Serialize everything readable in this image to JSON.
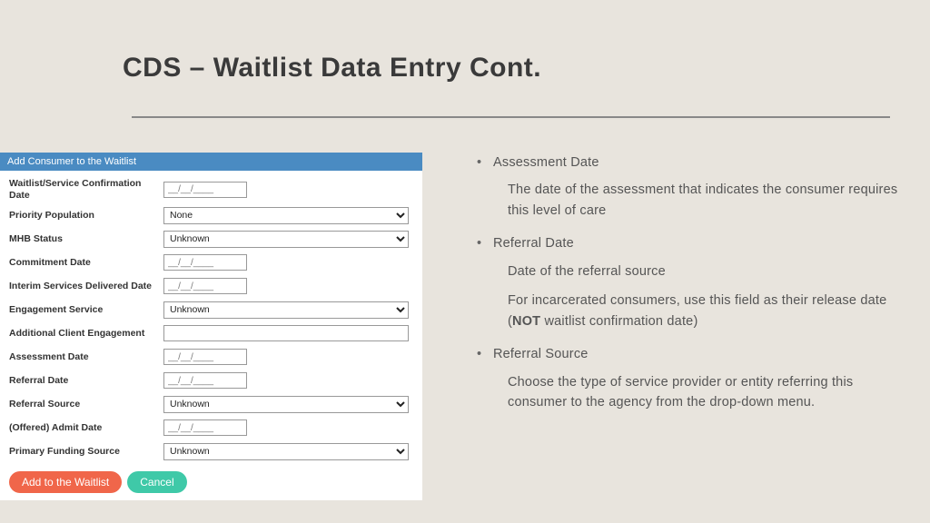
{
  "title": "CDS – Waitlist Data Entry Cont.",
  "form": {
    "header": "Add Consumer to the Waitlist",
    "datePlaceholder": "__/__/____",
    "rows": {
      "waitlistConfirm": "Waitlist/Service Confirmation Date",
      "priorityPop": "Priority Population",
      "priorityPopVal": "None",
      "mhbStatus": "MHB Status",
      "mhbStatusVal": "Unknown",
      "commitDate": "Commitment Date",
      "interimDate": "Interim Services Delivered Date",
      "engageService": "Engagement Service",
      "engageServiceVal": "Unknown",
      "addlEngage": "Additional Client Engagement",
      "assessDate": "Assessment Date",
      "referralDate": "Referral Date",
      "referralSource": "Referral Source",
      "referralSourceVal": "Unknown",
      "offeredAdmit": "(Offered) Admit Date",
      "primaryFunding": "Primary Funding Source",
      "primaryFundingVal": "Unknown"
    },
    "buttons": {
      "add": "Add to the Waitlist",
      "cancel": "Cancel"
    }
  },
  "explain": {
    "b1": {
      "title": "Assessment Date",
      "p1": "The date of the assessment that indicates the consumer requires this level of care"
    },
    "b2": {
      "title": "Referral Date",
      "p1": "Date of the referral source",
      "p2a": "For incarcerated consumers, use this field as their release date (",
      "p2b": "NOT",
      "p2c": " waitlist confirmation date)"
    },
    "b3": {
      "title": "Referral Source",
      "p1": "Choose the type of service provider or entity referring this consumer to the agency from the drop-down menu."
    }
  }
}
